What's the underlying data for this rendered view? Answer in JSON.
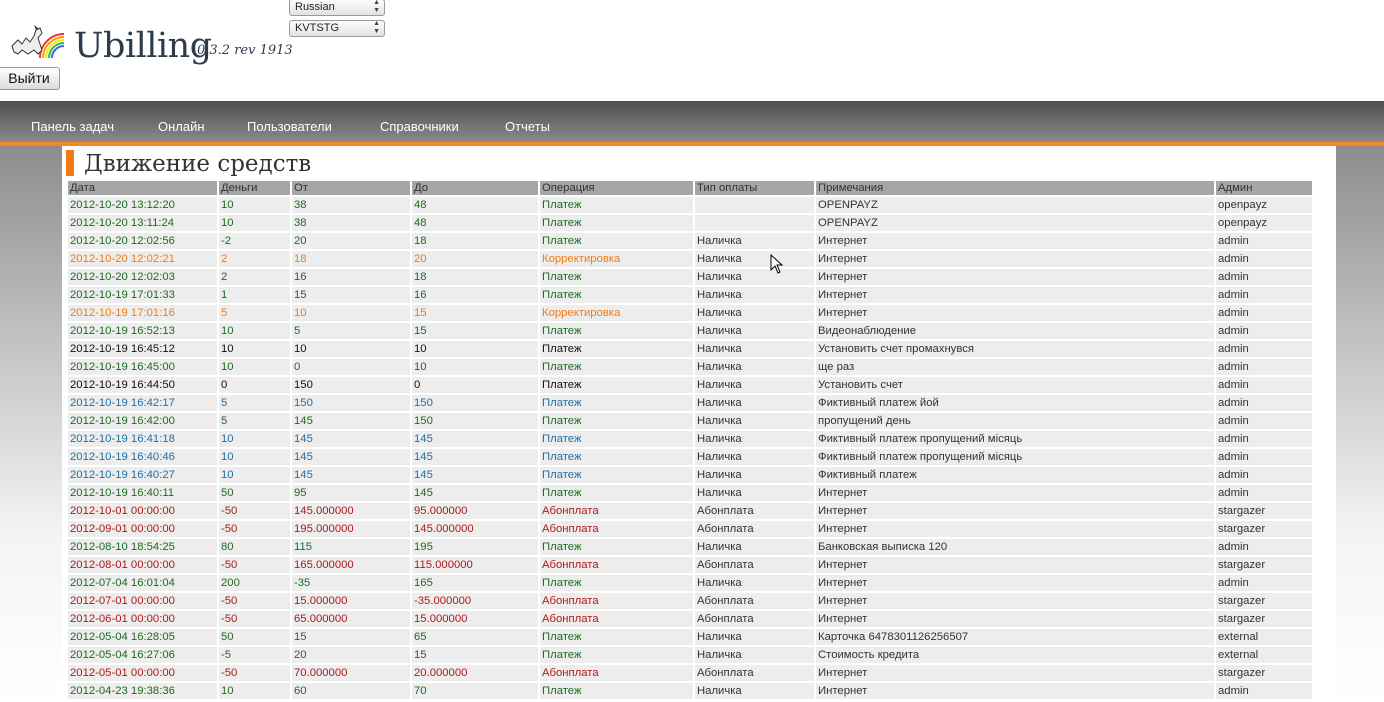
{
  "header": {
    "brand": "Ubilling",
    "version": "0.3.2 rev 1913",
    "language_select": "Russian",
    "skin_select": "KVTSTG",
    "logout_label": "Выйти"
  },
  "nav": {
    "items": [
      "Панель задач",
      "Онлайн",
      "Пользователи",
      "Справочники",
      "Отчеты"
    ]
  },
  "page": {
    "title": "Движение средств"
  },
  "table": {
    "columns": [
      "Дата",
      "Деньги",
      "От",
      "До",
      "Операция",
      "Тип оплаты",
      "Примечания",
      "Админ"
    ],
    "rows": [
      {
        "style": "pay",
        "cells": [
          "2012-10-20 13:12:20",
          "10",
          "38",
          "48",
          "Платеж",
          "",
          "OPENPAYZ",
          "openpayz"
        ]
      },
      {
        "style": "pay",
        "cells": [
          "2012-10-20 13:11:24",
          "10",
          "38",
          "48",
          "Платеж",
          "",
          "OPENPAYZ",
          "openpayz"
        ]
      },
      {
        "style": "pay",
        "cells": [
          "2012-10-20 12:02:56",
          "-2",
          "20",
          "18",
          "Платеж",
          "Наличка",
          "Интернет",
          "admin"
        ]
      },
      {
        "style": "corr",
        "cells": [
          "2012-10-20 12:02:21",
          "2",
          "18",
          "20",
          "Корректировка",
          "Наличка",
          "Интернет",
          "admin"
        ]
      },
      {
        "style": "pay",
        "cells": [
          "2012-10-20 12:02:03",
          "2",
          "16",
          "18",
          "Платеж",
          "Наличка",
          "Интернет",
          "admin"
        ]
      },
      {
        "style": "pay",
        "cells": [
          "2012-10-19 17:01:33",
          "1",
          "15",
          "16",
          "Платеж",
          "Наличка",
          "Интернет",
          "admin"
        ]
      },
      {
        "style": "corr",
        "cells": [
          "2012-10-19 17:01:16",
          "5",
          "10",
          "15",
          "Корректировка",
          "Наличка",
          "Интернет",
          "admin"
        ]
      },
      {
        "style": "pay",
        "cells": [
          "2012-10-19 16:52:13",
          "10",
          "5",
          "15",
          "Платеж",
          "Наличка",
          "Видеонаблюдение",
          "admin"
        ]
      },
      {
        "style": "black",
        "cells": [
          "2012-10-19 16:45:12",
          "10",
          "10",
          "10",
          "Платеж",
          "Наличка",
          "Установить счет промахнувся",
          "admin"
        ]
      },
      {
        "style": "pay",
        "cells": [
          "2012-10-19 16:45:00",
          "10",
          "0",
          "10",
          "Платеж",
          "Наличка",
          "ще раз",
          "admin"
        ]
      },
      {
        "style": "black",
        "cells": [
          "2012-10-19 16:44:50",
          "0",
          "150",
          "0",
          "Платеж",
          "Наличка",
          "Установить счет",
          "admin"
        ]
      },
      {
        "style": "blue",
        "cells": [
          "2012-10-19 16:42:17",
          "5",
          "150",
          "150",
          "Платеж",
          "Наличка",
          "Фиктивный платеж йой",
          "admin"
        ]
      },
      {
        "style": "pay",
        "cells": [
          "2012-10-19 16:42:00",
          "5",
          "145",
          "150",
          "Платеж",
          "Наличка",
          "пропущений день",
          "admin"
        ]
      },
      {
        "style": "blue",
        "cells": [
          "2012-10-19 16:41:18",
          "10",
          "145",
          "145",
          "Платеж",
          "Наличка",
          "Фиктивный платеж пропущений місяць",
          "admin"
        ]
      },
      {
        "style": "blue",
        "cells": [
          "2012-10-19 16:40:46",
          "10",
          "145",
          "145",
          "Платеж",
          "Наличка",
          "Фиктивный платеж пропущений місяць",
          "admin"
        ]
      },
      {
        "style": "blue",
        "cells": [
          "2012-10-19 16:40:27",
          "10",
          "145",
          "145",
          "Платеж",
          "Наличка",
          "Фиктивный платеж",
          "admin"
        ]
      },
      {
        "style": "pay",
        "cells": [
          "2012-10-19 16:40:11",
          "50",
          "95",
          "145",
          "Платеж",
          "Наличка",
          "Интернет",
          "admin"
        ]
      },
      {
        "style": "red",
        "cells": [
          "2012-10-01 00:00:00",
          "-50",
          "145.000000",
          "95.000000",
          "Абонплата",
          "Абонплата",
          "Интернет",
          "stargazer"
        ]
      },
      {
        "style": "red",
        "cells": [
          "2012-09-01 00:00:00",
          "-50",
          "195.000000",
          "145.000000",
          "Абонплата",
          "Абонплата",
          "Интернет",
          "stargazer"
        ]
      },
      {
        "style": "pay",
        "cells": [
          "2012-08-10 18:54:25",
          "80",
          "115",
          "195",
          "Платеж",
          "Наличка",
          "Банковская выписка 120",
          "admin"
        ]
      },
      {
        "style": "red",
        "cells": [
          "2012-08-01 00:00:00",
          "-50",
          "165.000000",
          "115.000000",
          "Абонплата",
          "Абонплата",
          "Интернет",
          "stargazer"
        ]
      },
      {
        "style": "pay",
        "cells": [
          "2012-07-04 16:01:04",
          "200",
          "-35",
          "165",
          "Платеж",
          "Наличка",
          "Интернет",
          "admin"
        ]
      },
      {
        "style": "red",
        "cells": [
          "2012-07-01 00:00:00",
          "-50",
          "15.000000",
          "-35.000000",
          "Абонплата",
          "Абонплата",
          "Интернет",
          "stargazer"
        ]
      },
      {
        "style": "red",
        "cells": [
          "2012-06-01 00:00:00",
          "-50",
          "65.000000",
          "15.000000",
          "Абонплата",
          "Абонплата",
          "Интернет",
          "stargazer"
        ]
      },
      {
        "style": "pay",
        "cells": [
          "2012-05-04 16:28:05",
          "50",
          "15",
          "65",
          "Платеж",
          "Наличка",
          "Карточка 6478301126256507",
          "external"
        ]
      },
      {
        "style": "pay",
        "cells": [
          "2012-05-04 16:27:06",
          "-5",
          "20",
          "15",
          "Платеж",
          "Наличка",
          "Стоимость кредита",
          "external"
        ]
      },
      {
        "style": "red",
        "cells": [
          "2012-05-01 00:00:00",
          "-50",
          "70.000000",
          "20.000000",
          "Абонплата",
          "Абонплата",
          "Интернет",
          "stargazer"
        ]
      },
      {
        "style": "pay",
        "cells": [
          "2012-04-23 19:38:36",
          "10",
          "60",
          "70",
          "Платеж",
          "Наличка",
          "Интернет",
          "admin"
        ]
      }
    ]
  },
  "colors": {
    "accent": "#f07c15",
    "payment": "#1e6b1e",
    "correction": "#f07c15",
    "fee": "#b01818",
    "fictive": "#1f6fa6"
  }
}
